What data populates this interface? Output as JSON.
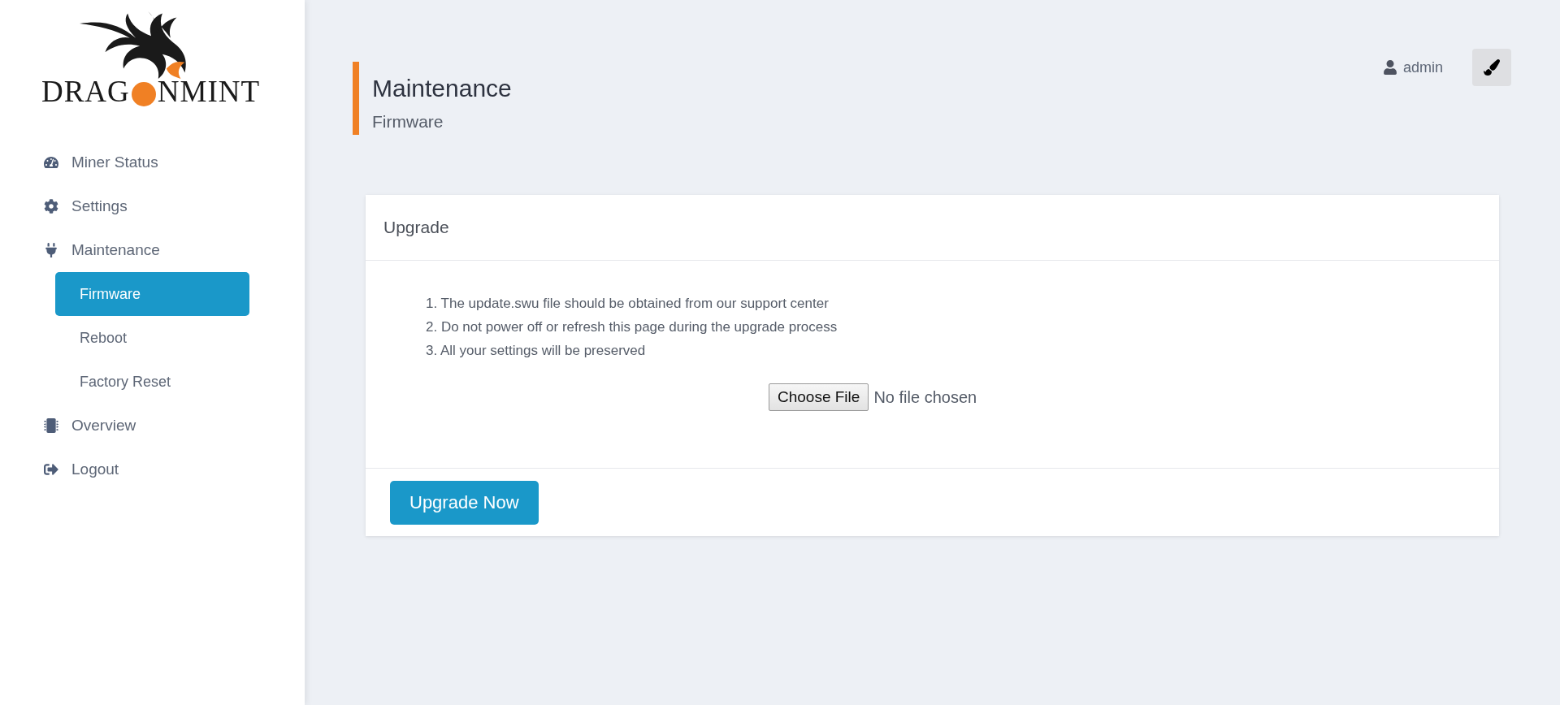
{
  "logo": {
    "text_before": "DRAG",
    "text_after": "NMINT"
  },
  "sidebar": {
    "items": [
      {
        "label": "Miner Status",
        "selected": false
      },
      {
        "label": "Settings",
        "selected": false
      },
      {
        "label": "Maintenance",
        "selected": false,
        "children": [
          {
            "label": "Firmware",
            "selected": true
          },
          {
            "label": "Reboot",
            "selected": false
          },
          {
            "label": "Factory Reset",
            "selected": false
          }
        ]
      },
      {
        "label": "Overview",
        "selected": false
      },
      {
        "label": "Logout",
        "selected": false
      }
    ]
  },
  "header": {
    "title": "Maintenance",
    "subtitle": "Firmware",
    "user": "admin"
  },
  "card": {
    "title": "Upgrade",
    "instructions": [
      "1. The update.swu file should be obtained from our support center",
      "2. Do not power off or refresh this page during the upgrade process",
      "3. All your settings will be preserved"
    ],
    "file_button": "Choose File",
    "file_status": "No file chosen",
    "submit": "Upgrade Now"
  }
}
